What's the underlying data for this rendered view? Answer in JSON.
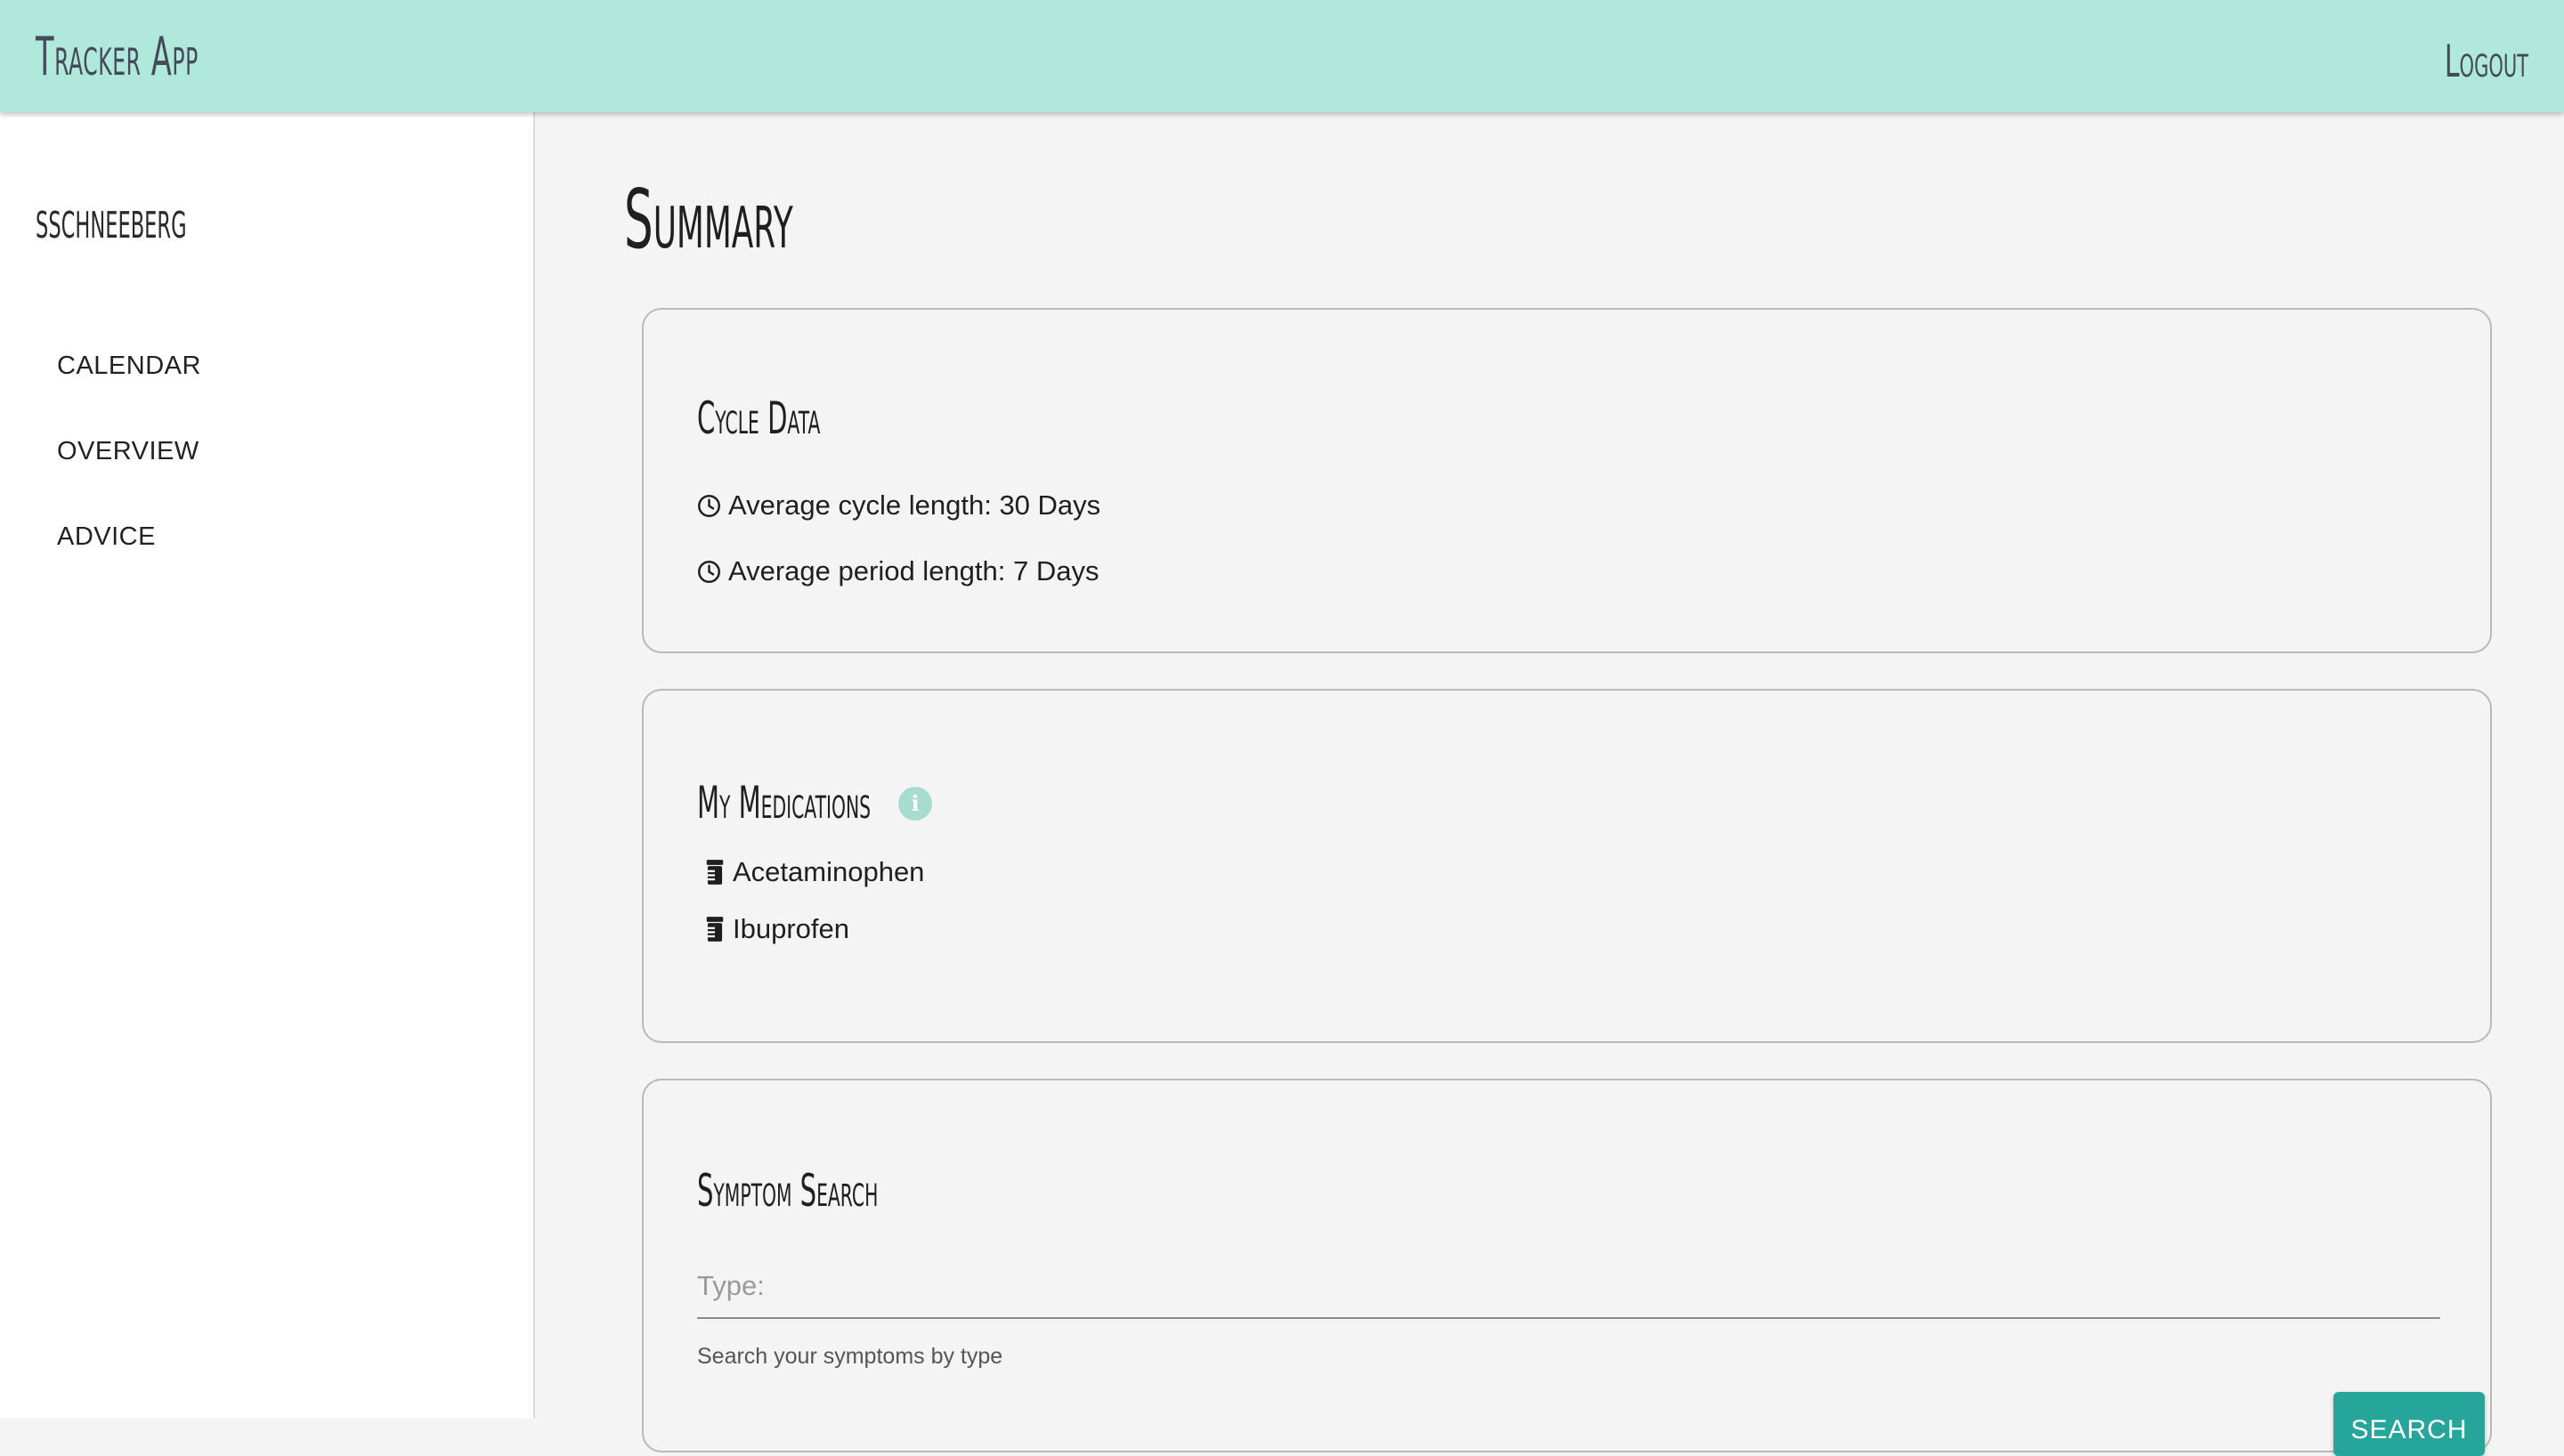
{
  "header": {
    "app_title": "Tracker App",
    "logout_label": "Logout"
  },
  "sidebar": {
    "username": "sschneeberg",
    "items": [
      {
        "label": "CALENDAR"
      },
      {
        "label": "OVERVIEW"
      },
      {
        "label": "ADVICE"
      }
    ]
  },
  "main": {
    "page_title": "Summary",
    "cycle_card": {
      "title": "Cycle Data",
      "stats": [
        {
          "text": "Average cycle length: 30 Days",
          "icon": "clock-icon"
        },
        {
          "text": "Average period length: 7 Days",
          "icon": "clock-icon"
        }
      ]
    },
    "medications_card": {
      "title": "My Medications",
      "info_icon": "info-icon",
      "info_glyph": "i",
      "items": [
        {
          "name": "Acetaminophen",
          "icon": "pill-bottle-icon"
        },
        {
          "name": "Ibuprofen",
          "icon": "pill-bottle-icon"
        }
      ]
    },
    "symptom_card": {
      "title": "Symptom Search",
      "input_placeholder": "Type:",
      "input_value": "",
      "helper_text": "Search your symptoms by type",
      "button_label": "Search"
    }
  },
  "colors": {
    "header_bg": "#b0e9db",
    "accent": "#26a69a",
    "info_badge": "#a6ddd0",
    "page_bg": "#f4f4f4"
  }
}
